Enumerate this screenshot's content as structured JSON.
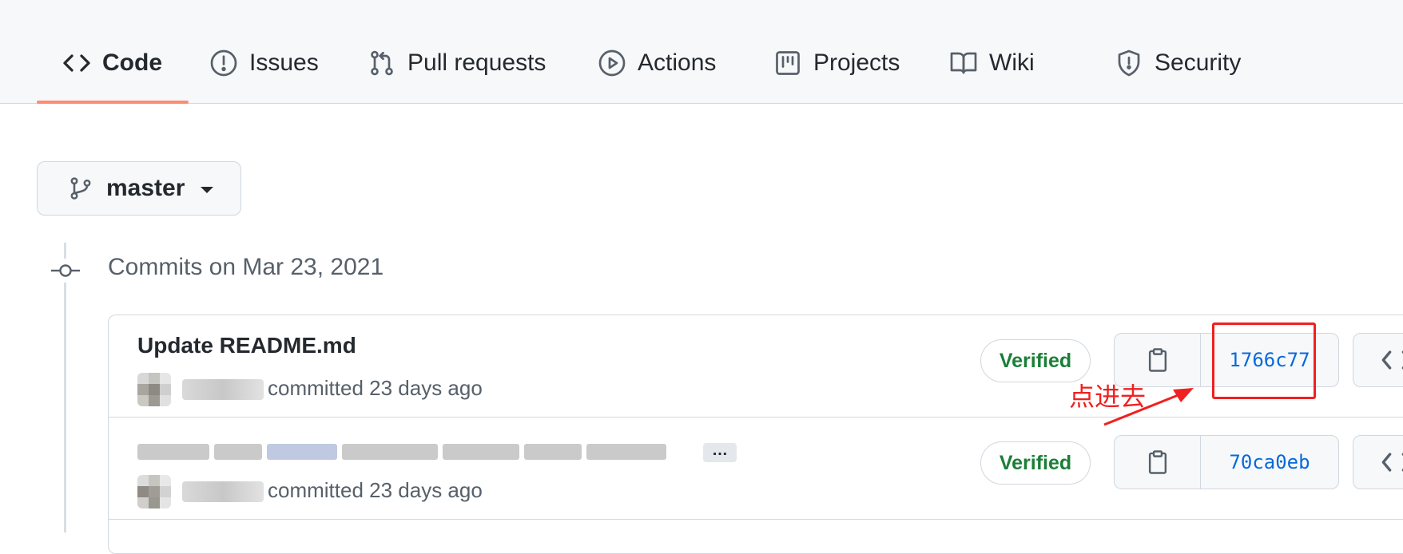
{
  "nav": {
    "tabs": [
      {
        "label": "Code",
        "icon": "code-icon",
        "selected": true
      },
      {
        "label": "Issues",
        "icon": "issue-opened-icon"
      },
      {
        "label": "Pull requests",
        "icon": "git-pull-request-icon"
      },
      {
        "label": "Actions",
        "icon": "play-icon"
      },
      {
        "label": "Projects",
        "icon": "project-icon"
      },
      {
        "label": "Wiki",
        "icon": "book-icon"
      },
      {
        "label": "Security",
        "icon": "shield-icon"
      }
    ],
    "underline_color": "#fd8c73"
  },
  "branch": {
    "name": "master",
    "icon": "git-branch-icon"
  },
  "timeline": {
    "heading": "Commits on Mar 23, 2021",
    "icon": "git-commit-icon"
  },
  "commits": [
    {
      "title": "Update README.md",
      "meta": "committed 23 days ago",
      "badge": "Verified",
      "sha": "1766c77",
      "copy_icon": "clipboard-icon",
      "browse_icon": "code-icon"
    },
    {
      "title_obscured": true,
      "ellipsis": "…",
      "meta": "committed 23 days ago",
      "badge": "Verified",
      "sha": "70ca0eb",
      "copy_icon": "clipboard-icon",
      "browse_icon": "code-icon"
    }
  ],
  "annotation": {
    "text": "点进去",
    "color": "#f02020"
  },
  "colors": {
    "verified": "#1a7f37",
    "link": "#0969da",
    "nav_bg": "#f6f8fa",
    "border": "#d0d7de"
  }
}
